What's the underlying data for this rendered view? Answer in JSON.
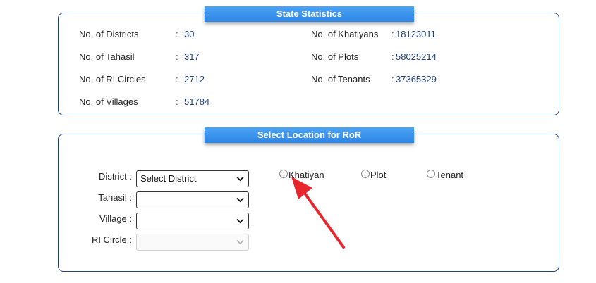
{
  "state_statistics": {
    "title": "State Statistics",
    "left": [
      {
        "label": "No. of Districts",
        "value": "30"
      },
      {
        "label": "No. of Tahasil",
        "value": "317"
      },
      {
        "label": "No. of RI Circles",
        "value": "2712"
      },
      {
        "label": "No. of Villages",
        "value": "51784"
      }
    ],
    "right": [
      {
        "label": "No. of Khatiyans",
        "value": "18123011"
      },
      {
        "label": "No. of Plots",
        "value": "58025214"
      },
      {
        "label": "No. of Tenants",
        "value": "37365329"
      }
    ],
    "colon": ":"
  },
  "select_location": {
    "title": "Select Location for RoR",
    "district": {
      "label": "District :",
      "value": "Select District"
    },
    "tahasil": {
      "label": "Tahasil :",
      "value": ""
    },
    "village": {
      "label": "Village :",
      "value": ""
    },
    "ri_circle": {
      "label": "RI Circle :",
      "value": "",
      "disabled": true
    },
    "radios": [
      {
        "label": "Khatiyan",
        "checked": false
      },
      {
        "label": "Plot",
        "checked": false
      },
      {
        "label": "Tenant",
        "checked": false
      }
    ]
  },
  "annotation": {
    "arrow_color": "#e8262d",
    "icon": "red-arrow-icon"
  }
}
